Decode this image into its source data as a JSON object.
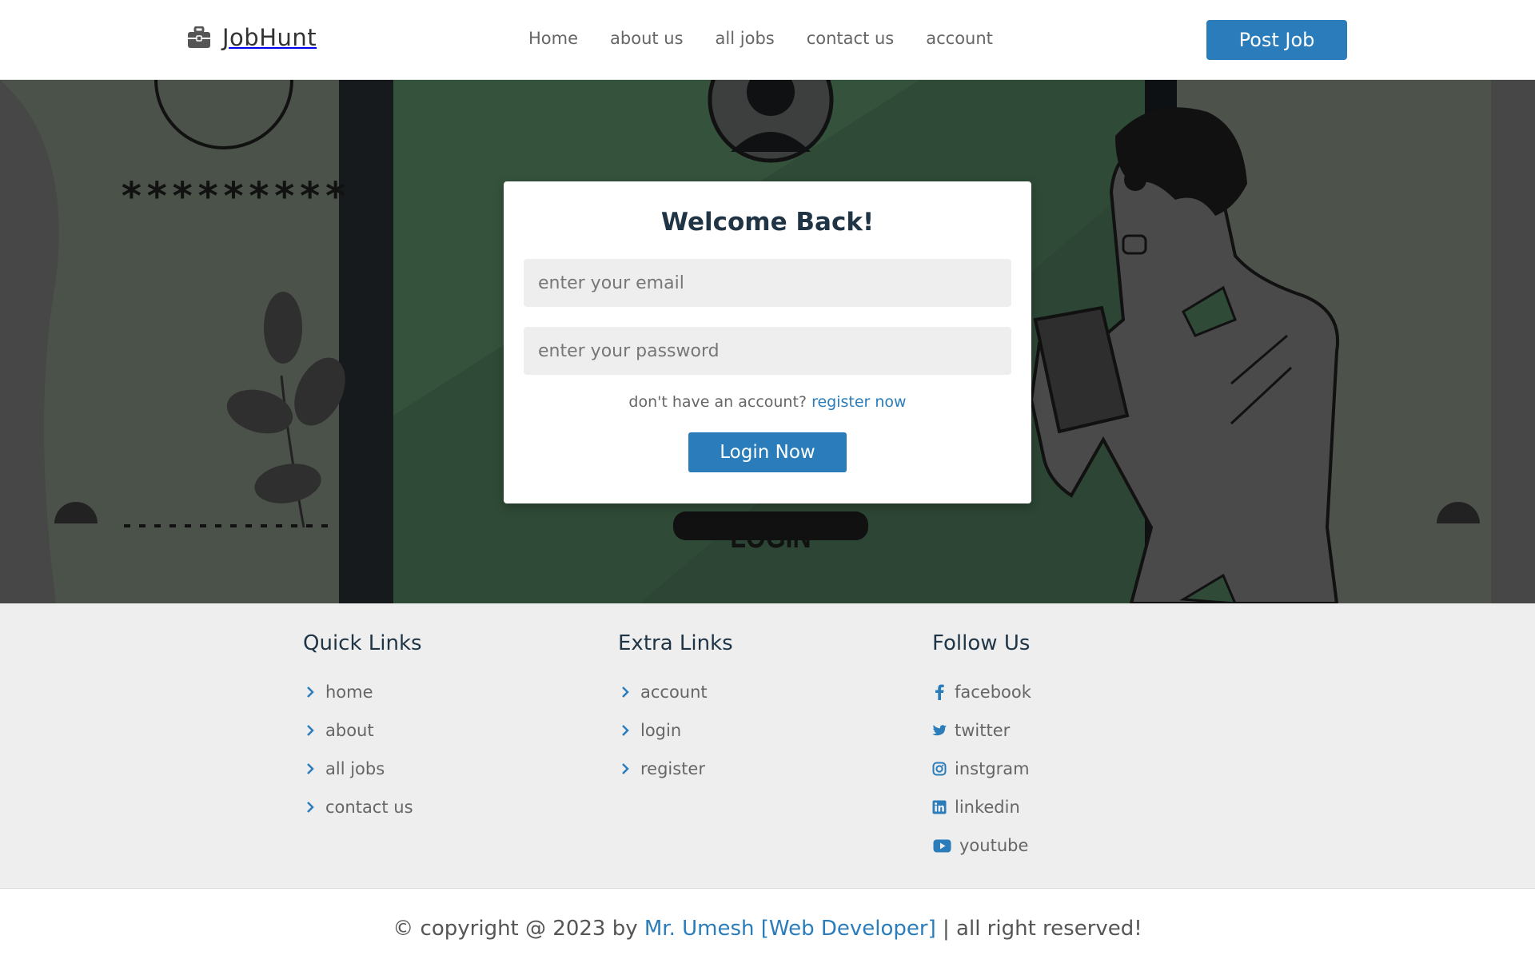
{
  "header": {
    "brand": "JobHunt",
    "nav": [
      "Home",
      "about us",
      "all jobs",
      "contact us",
      "account"
    ],
    "post_job": "Post Job"
  },
  "login": {
    "title": "Welcome Back!",
    "email_placeholder": "enter your email",
    "password_placeholder": "enter your password",
    "register_prompt": "don't have an account?",
    "register_link": "register now",
    "button": "Login Now"
  },
  "hero_art": {
    "stars": "*********",
    "login_label": "LOGIN"
  },
  "footer": {
    "quick": {
      "title": "Quick Links",
      "items": [
        "home",
        "about",
        "all jobs",
        "contact us"
      ]
    },
    "extra": {
      "title": "Extra Links",
      "items": [
        "account",
        "login",
        "register"
      ]
    },
    "follow": {
      "title": "Follow Us",
      "items": [
        {
          "label": "facebook",
          "icon": "facebook-icon"
        },
        {
          "label": "twitter",
          "icon": "twitter-icon"
        },
        {
          "label": "instgram",
          "icon": "instagram-icon"
        },
        {
          "label": "linkedin",
          "icon": "linkedin-icon"
        },
        {
          "label": "youtube",
          "icon": "youtube-icon"
        }
      ]
    }
  },
  "copyright": {
    "prefix": "© copyright @ 2023 by",
    "author": "Mr. Umesh [Web Developer]",
    "suffix": "| all right reserved!"
  },
  "colors": {
    "accent": "#2a7dba",
    "hero_overlay": "#474747",
    "hero_green": "#2f4a37"
  }
}
